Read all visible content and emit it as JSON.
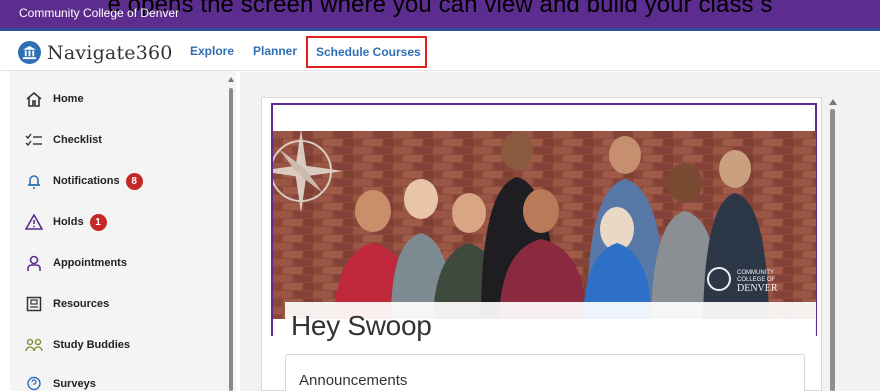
{
  "caption": {
    "text": "e opens the screen where you can view and build your class s"
  },
  "college": {
    "name": "Community College of Denver"
  },
  "topnav": {
    "logo_text": "Navigate360",
    "links": [
      {
        "label": "Explore"
      },
      {
        "label": "Planner"
      },
      {
        "label": "Schedule Courses",
        "highlighted": true
      }
    ]
  },
  "sidebar": {
    "items": [
      {
        "label": "Home",
        "icon": "home-icon"
      },
      {
        "label": "Checklist",
        "icon": "checklist-icon"
      },
      {
        "label": "Notifications",
        "icon": "bell-icon",
        "badge": "8"
      },
      {
        "label": "Holds",
        "icon": "warning-icon",
        "badge": "1"
      },
      {
        "label": "Appointments",
        "icon": "person-icon"
      },
      {
        "label": "Resources",
        "icon": "resources-icon"
      },
      {
        "label": "Study Buddies",
        "icon": "people-icon"
      },
      {
        "label": "Surveys",
        "icon": "chat-icon"
      }
    ]
  },
  "main": {
    "greeting": "Hey Swoop",
    "announcements_title": "Announcements",
    "banner_logo": {
      "line1": "COMMUNITY",
      "line2": "COLLEGE OF",
      "line3": "DENVER"
    }
  },
  "colors": {
    "brand_purple": "#5c2d8f",
    "link_blue": "#2f6fb5",
    "badge_red": "#c62828",
    "highlight_red": "#e02020"
  }
}
